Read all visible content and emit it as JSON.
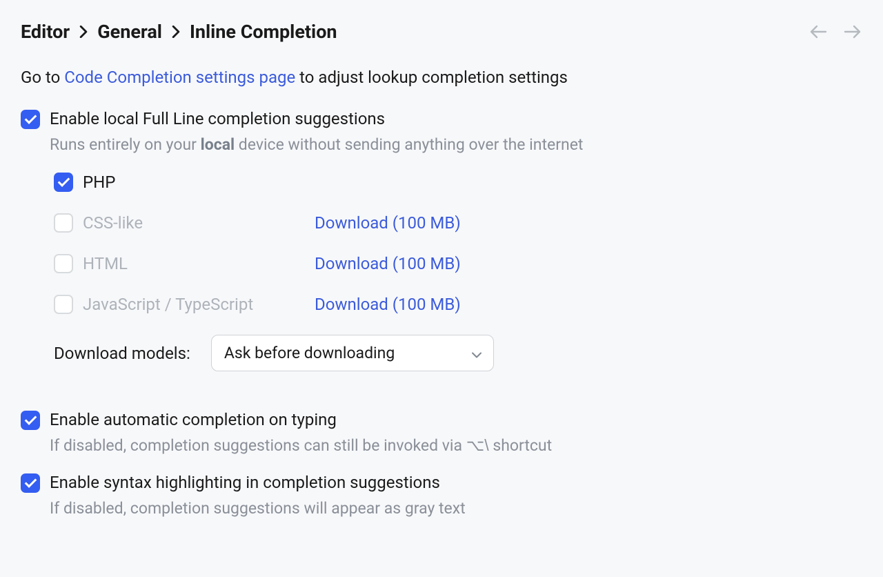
{
  "breadcrumb": {
    "p1": "Editor",
    "p2": "General",
    "p3": "Inline Completion"
  },
  "intro": {
    "prefix": "Go to ",
    "link": "Code Completion settings page",
    "suffix": " to adjust lookup completion settings"
  },
  "fullLine": {
    "title": "Enable local Full Line completion suggestions",
    "desc_pre": "Runs entirely on your ",
    "desc_bold": "local",
    "desc_post": " device without sending anything over the internet"
  },
  "langs": {
    "php": "PHP",
    "css": "CSS-like",
    "html": "HTML",
    "js": "JavaScript / TypeScript",
    "download_css": "Download (100 MB)",
    "download_html": "Download (100 MB)",
    "download_js": "Download (100 MB)"
  },
  "downloadModels": {
    "label": "Download models:",
    "value": "Ask before downloading"
  },
  "autoTyping": {
    "title": "Enable automatic completion on typing",
    "desc_pre": "If disabled, completion suggestions can still be invoked via ",
    "shortcut": "⌥\\",
    "desc_post": " shortcut"
  },
  "syntaxHl": {
    "title": "Enable syntax highlighting in completion suggestions",
    "desc": "If disabled, completion suggestions will appear as gray text"
  }
}
